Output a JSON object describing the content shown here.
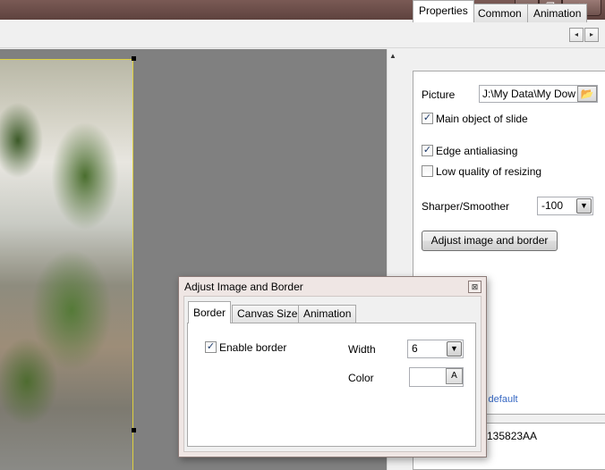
{
  "window": {
    "minimize_glyph": "—",
    "restore_glyph": "❐",
    "close_glyph": "✕"
  },
  "scroll": {
    "left_glyph": "◂",
    "right_glyph": "▸",
    "up_glyph": "▲"
  },
  "properties_panel": {
    "tabs": [
      {
        "label": "Properties",
        "active": true
      },
      {
        "label": "Common",
        "active": false
      },
      {
        "label": "Animation",
        "active": false
      }
    ],
    "picture_label": "Picture",
    "picture_path": "J:\\My Data\\My Dow",
    "folder_glyph": "📂",
    "main_object": {
      "label": "Main object of slide",
      "checked": true
    },
    "edge_antialiasing": {
      "label": "Edge antialiasing",
      "checked": true
    },
    "low_quality": {
      "label": "Low quality of resizing",
      "checked": false
    },
    "sharper_label": "Sharper/Smoother",
    "sharper_value": "-100",
    "adjust_button": "Adjust image and border",
    "default_link": "y default",
    "color_code": "135823AA"
  },
  "dialog": {
    "title": "Adjust Image and Border",
    "close_glyph": "⊠",
    "tabs": [
      {
        "label": "Border",
        "active": true
      },
      {
        "label": "Canvas Size",
        "active": false
      },
      {
        "label": "Animation",
        "active": false
      }
    ],
    "enable_border": {
      "label": "Enable border",
      "checked": true
    },
    "width_label": "Width",
    "width_value": "6",
    "color_label": "Color",
    "color_button": "A"
  },
  "glyphs": {
    "check": "✓",
    "dropdown": "▼"
  }
}
